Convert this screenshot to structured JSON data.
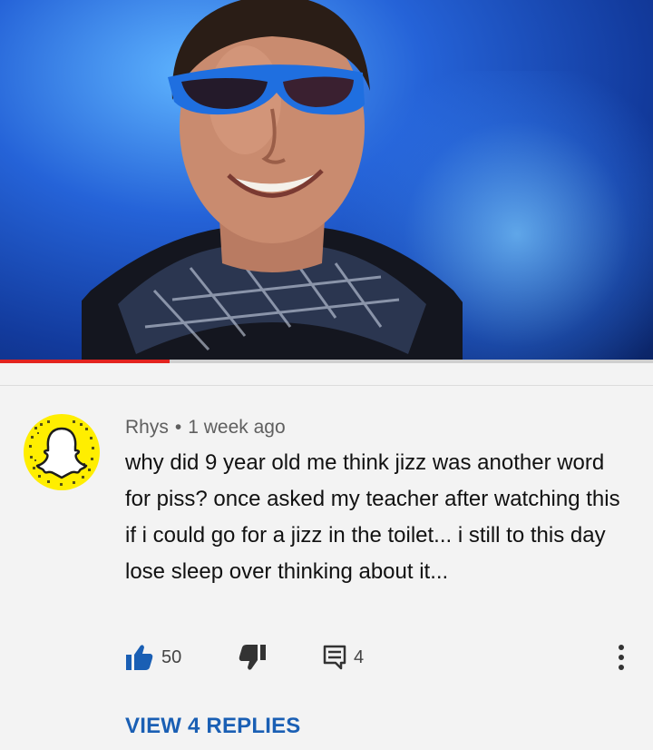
{
  "video": {
    "accent_color": "#e3241f",
    "progress_fraction": 0.26
  },
  "comment": {
    "avatar_icon": "snapchat-ghost-icon",
    "author": "Rhys",
    "separator": "•",
    "time": "1 week ago",
    "text": "why did 9 year old me think jizz was another word for piss? once asked my teacher after watching this if i could go for a jizz in the toilet... i still to this day lose sleep over thinking about it..."
  },
  "actions": {
    "like_icon": "thumbs-up-icon",
    "like_count": "50",
    "dislike_icon": "thumbs-down-icon",
    "reply_icon": "comment-icon",
    "reply_count": "4",
    "more_icon": "more-vertical-icon",
    "like_color": "#1a5fb4"
  },
  "replies": {
    "label": "VIEW 4 REPLIES"
  }
}
